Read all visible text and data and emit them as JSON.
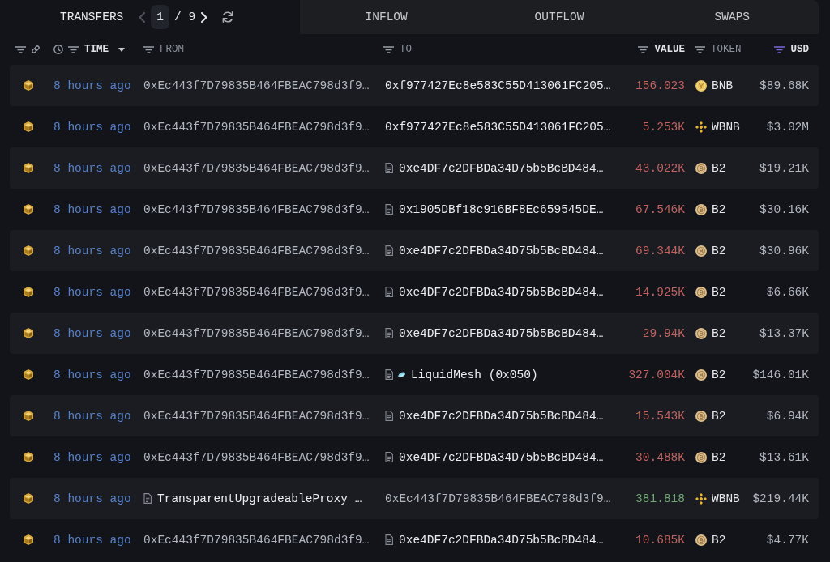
{
  "tabs": [
    {
      "label": "TRANSFERS",
      "selected": true
    },
    {
      "label": "INFLOW",
      "selected": false
    },
    {
      "label": "OUTFLOW",
      "selected": false
    },
    {
      "label": "SWAPS",
      "selected": false
    }
  ],
  "pager": {
    "page": "1",
    "total": "/ 9",
    "previous_disabled": true,
    "next_disabled": false
  },
  "columns": [
    {
      "label": "TIME",
      "highlighted": true,
      "sorted": true,
      "filter_active": false
    },
    {
      "label": "FROM",
      "highlighted": false,
      "sorted": false,
      "filter_active": false
    },
    {
      "label": "TO",
      "highlighted": false,
      "sorted": false,
      "filter_active": false
    },
    {
      "label": "VALUE",
      "highlighted": true,
      "sorted": false,
      "filter_active": false
    },
    {
      "label": "TOKEN",
      "highlighted": false,
      "sorted": false,
      "filter_active": false
    },
    {
      "label": "USD",
      "highlighted": true,
      "sorted": false,
      "filter_active": true
    }
  ],
  "rows": [
    {
      "time": "8 hours ago",
      "from": {
        "text": "0xEc443f7D79835B464FBEAC798d3f9…",
        "contract": false,
        "logo": false,
        "dimmed": true
      },
      "to": {
        "text": "0xf977427Ec8e583C55D413061FC205…",
        "contract": false,
        "logo": false,
        "dimmed": false
      },
      "value": "156.023",
      "incoming": false,
      "token": {
        "symbol": "BNB",
        "kind": "gold"
      },
      "usd": "$89.68K"
    },
    {
      "time": "8 hours ago",
      "from": {
        "text": "0xEc443f7D79835B464FBEAC798d3f9…",
        "contract": false,
        "logo": false,
        "dimmed": true
      },
      "to": {
        "text": "0xf977427Ec8e583C55D413061FC205…",
        "contract": false,
        "logo": false,
        "dimmed": false
      },
      "value": "5.253K",
      "incoming": false,
      "token": {
        "symbol": "WBNB",
        "kind": "diamond"
      },
      "usd": "$3.02M"
    },
    {
      "time": "8 hours ago",
      "from": {
        "text": "0xEc443f7D79835B464FBEAC798d3f9…",
        "contract": false,
        "logo": false,
        "dimmed": true
      },
      "to": {
        "text": "0xe4DF7c2DFBDa34D75b5BcBD484…",
        "contract": true,
        "logo": false,
        "dimmed": false
      },
      "value": "43.022K",
      "incoming": false,
      "token": {
        "symbol": "B2",
        "kind": "beige"
      },
      "usd": "$19.21K"
    },
    {
      "time": "8 hours ago",
      "from": {
        "text": "0xEc443f7D79835B464FBEAC798d3f9…",
        "contract": false,
        "logo": false,
        "dimmed": true
      },
      "to": {
        "text": "0x1905DBf18c916BF8Ec659545DE…",
        "contract": true,
        "logo": false,
        "dimmed": false
      },
      "value": "67.546K",
      "incoming": false,
      "token": {
        "symbol": "B2",
        "kind": "beige"
      },
      "usd": "$30.16K"
    },
    {
      "time": "8 hours ago",
      "from": {
        "text": "0xEc443f7D79835B464FBEAC798d3f9…",
        "contract": false,
        "logo": false,
        "dimmed": true
      },
      "to": {
        "text": "0xe4DF7c2DFBDa34D75b5BcBD484…",
        "contract": true,
        "logo": false,
        "dimmed": false
      },
      "value": "69.344K",
      "incoming": false,
      "token": {
        "symbol": "B2",
        "kind": "beige"
      },
      "usd": "$30.96K"
    },
    {
      "time": "8 hours ago",
      "from": {
        "text": "0xEc443f7D79835B464FBEAC798d3f9…",
        "contract": false,
        "logo": false,
        "dimmed": true
      },
      "to": {
        "text": "0xe4DF7c2DFBDa34D75b5BcBD484…",
        "contract": true,
        "logo": false,
        "dimmed": false
      },
      "value": "14.925K",
      "incoming": false,
      "token": {
        "symbol": "B2",
        "kind": "beige"
      },
      "usd": "$6.66K"
    },
    {
      "time": "8 hours ago",
      "from": {
        "text": "0xEc443f7D79835B464FBEAC798d3f9…",
        "contract": false,
        "logo": false,
        "dimmed": true
      },
      "to": {
        "text": "0xe4DF7c2DFBDa34D75b5BcBD484…",
        "contract": true,
        "logo": false,
        "dimmed": false
      },
      "value": "29.94K",
      "incoming": false,
      "token": {
        "symbol": "B2",
        "kind": "beige"
      },
      "usd": "$13.37K"
    },
    {
      "time": "8 hours ago",
      "from": {
        "text": "0xEc443f7D79835B464FBEAC798d3f9…",
        "contract": false,
        "logo": false,
        "dimmed": true
      },
      "to": {
        "text": "LiquidMesh (0x050)",
        "contract": true,
        "logo": true,
        "dimmed": false
      },
      "value": "327.004K",
      "incoming": false,
      "token": {
        "symbol": "B2",
        "kind": "beige"
      },
      "usd": "$146.01K"
    },
    {
      "time": "8 hours ago",
      "from": {
        "text": "0xEc443f7D79835B464FBEAC798d3f9…",
        "contract": false,
        "logo": false,
        "dimmed": true
      },
      "to": {
        "text": "0xe4DF7c2DFBDa34D75b5BcBD484…",
        "contract": true,
        "logo": false,
        "dimmed": false
      },
      "value": "15.543K",
      "incoming": false,
      "token": {
        "symbol": "B2",
        "kind": "beige"
      },
      "usd": "$6.94K"
    },
    {
      "time": "8 hours ago",
      "from": {
        "text": "0xEc443f7D79835B464FBEAC798d3f9…",
        "contract": false,
        "logo": false,
        "dimmed": true
      },
      "to": {
        "text": "0xe4DF7c2DFBDa34D75b5BcBD484…",
        "contract": true,
        "logo": false,
        "dimmed": false
      },
      "value": "30.488K",
      "incoming": false,
      "token": {
        "symbol": "B2",
        "kind": "beige"
      },
      "usd": "$13.61K"
    },
    {
      "time": "8 hours ago",
      "from": {
        "text": "TransparentUpgradeableProxy …",
        "contract": true,
        "logo": false,
        "dimmed": false
      },
      "to": {
        "text": "0xEc443f7D79835B464FBEAC798d3f9…",
        "contract": false,
        "logo": false,
        "dimmed": true
      },
      "value": "381.818",
      "incoming": true,
      "token": {
        "symbol": "WBNB",
        "kind": "diamond"
      },
      "usd": "$219.44K"
    },
    {
      "time": "8 hours ago",
      "from": {
        "text": "0xEc443f7D79835B464FBEAC798d3f9…",
        "contract": false,
        "logo": false,
        "dimmed": true
      },
      "to": {
        "text": "0xe4DF7c2DFBDa34D75b5BcBD484…",
        "contract": true,
        "logo": false,
        "dimmed": false
      },
      "value": "10.685K",
      "incoming": false,
      "token": {
        "symbol": "B2",
        "kind": "beige"
      },
      "usd": "$4.77K"
    }
  ]
}
